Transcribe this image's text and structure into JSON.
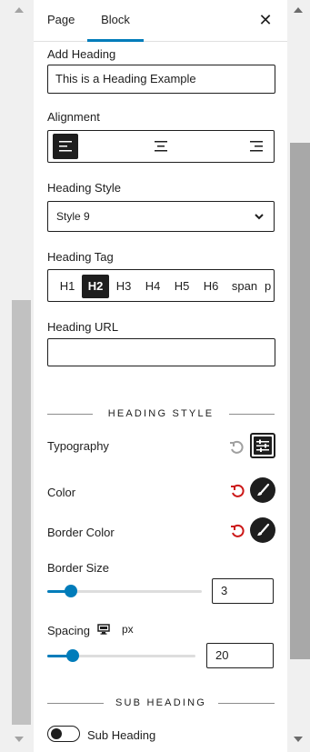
{
  "tabs": {
    "page": "Page",
    "block": "Block"
  },
  "close_symbol": "✕",
  "add_heading": {
    "label": "Add Heading",
    "value": "This is a Heading Example"
  },
  "alignment": {
    "label": "Alignment",
    "options": [
      "left",
      "center",
      "right"
    ],
    "selected": "left"
  },
  "heading_style": {
    "label": "Heading Style",
    "value": "Style 9"
  },
  "heading_tag": {
    "label": "Heading Tag",
    "options": [
      "H1",
      "H2",
      "H3",
      "H4",
      "H5",
      "H6",
      "span",
      "p"
    ],
    "selected": "H2"
  },
  "heading_url": {
    "label": "Heading URL",
    "value": ""
  },
  "section_heading_style": "HEADING STYLE",
  "typography": {
    "label": "Typography"
  },
  "color": {
    "label": "Color"
  },
  "border_color": {
    "label": "Border Color"
  },
  "border_size": {
    "label": "Border Size",
    "value": "3",
    "level": 0.15
  },
  "spacing": {
    "label": "Spacing",
    "unit": "px",
    "value": "20",
    "level": 0.17
  },
  "section_sub_heading": "SUB HEADING",
  "sub_heading_toggle": {
    "label": "Sub Heading",
    "enabled": false
  },
  "colors": {
    "accent": "#007cba",
    "reset_active": "#cc1818",
    "reset_inactive": "#a0a0a0",
    "dark": "#1e1e1e"
  }
}
